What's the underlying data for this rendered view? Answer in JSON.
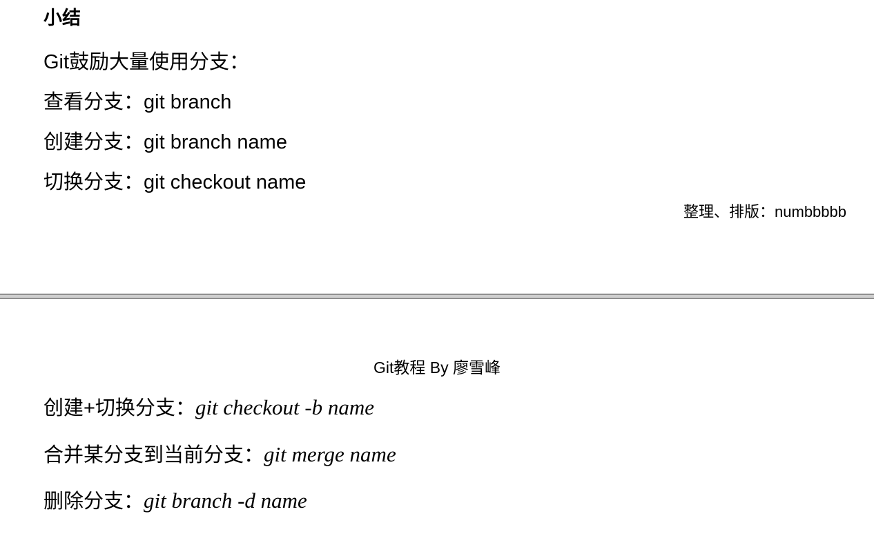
{
  "top_page": {
    "heading": "小结",
    "lines": [
      {
        "text": "Git鼓励大量使用分支："
      },
      {
        "label": "查看分支：",
        "command": "git branch"
      },
      {
        "label": "创建分支：",
        "command": "git branch name"
      },
      {
        "label": "切换分支：",
        "command": "git checkout name"
      }
    ],
    "credit": "整理、排版：numbbbbb"
  },
  "bottom_page": {
    "header": "Git教程 By 廖雪峰",
    "lines": [
      {
        "label": "创建+切换分支：",
        "command": "git checkout -b name"
      },
      {
        "label": "合并某分支到当前分支：",
        "command": "git merge name"
      },
      {
        "label": "删除分支：",
        "command": "git branch -d name"
      }
    ]
  }
}
